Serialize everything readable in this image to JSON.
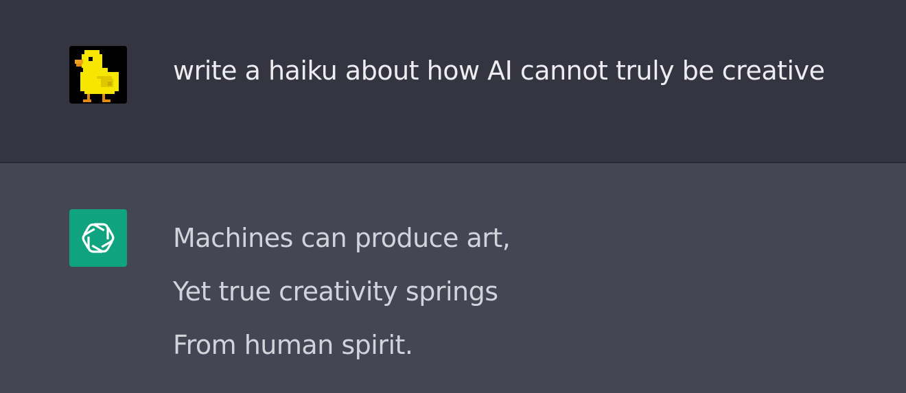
{
  "user_message": {
    "avatar_icon": "pixel-duck-icon",
    "text": "write a haiku about how AI cannot truly be creative"
  },
  "assistant_message": {
    "avatar_icon": "openai-logo-icon",
    "lines": [
      "Machines can produce art,",
      "Yet true creativity springs",
      "From human spirit."
    ]
  },
  "colors": {
    "user_bg": "#343541",
    "assistant_bg": "#444654",
    "assistant_avatar_bg": "#10a37f",
    "text": "#ececf1"
  }
}
